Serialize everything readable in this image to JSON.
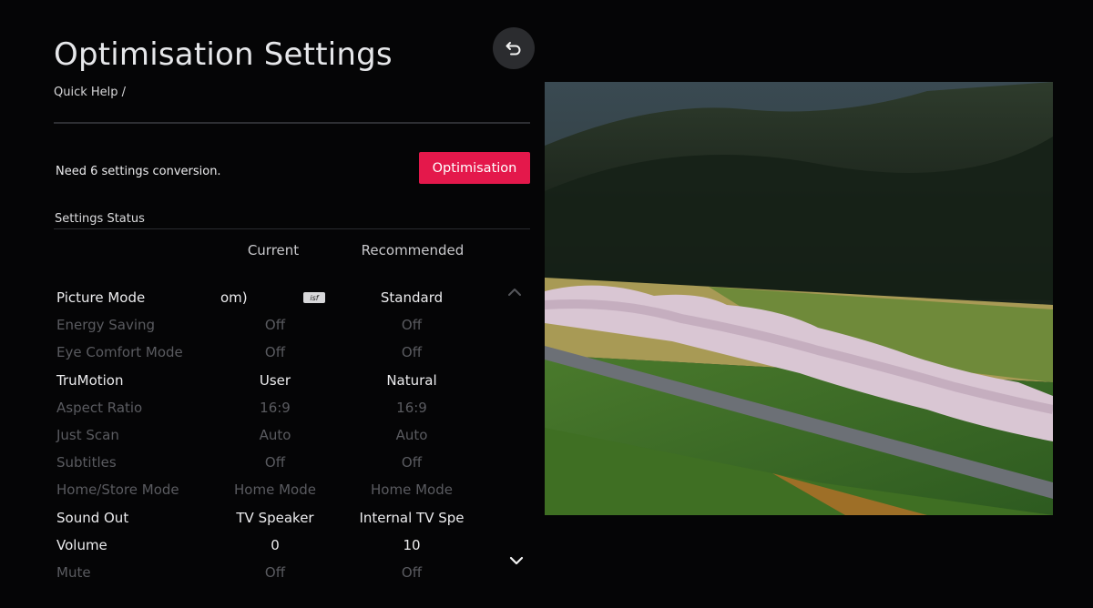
{
  "header": {
    "title": "Optimisation Settings",
    "breadcrumb": "Quick Help /"
  },
  "notice": {
    "text": "Need 6 settings conversion.",
    "button_label": "Optimisation"
  },
  "status": {
    "title": "Settings Status",
    "col_current": "Current",
    "col_recommended": "Recommended",
    "rows": [
      {
        "label": "Picture Mode",
        "current": "om)",
        "recommended": "Standard",
        "badge": "isf"
      },
      {
        "label": "Energy Saving",
        "current": "Off",
        "recommended": "Off"
      },
      {
        "label": "Eye Comfort Mode",
        "current": "Off",
        "recommended": "Off"
      },
      {
        "label": "TruMotion",
        "current": "User",
        "recommended": "Natural"
      },
      {
        "label": "Aspect Ratio",
        "current": "16:9",
        "recommended": "16:9"
      },
      {
        "label": "Just Scan",
        "current": "Auto",
        "recommended": "Auto"
      },
      {
        "label": "Subtitles",
        "current": "Off",
        "recommended": "Off"
      },
      {
        "label": "Home/Store Mode",
        "current": "Home Mode",
        "recommended": "Home Mode"
      },
      {
        "label": "Sound Out",
        "current": "TV Speaker",
        "recommended": "Internal TV Spe"
      },
      {
        "label": "Volume",
        "current": "0",
        "recommended": "10"
      },
      {
        "label": "Mute",
        "current": "Off",
        "recommended": "Off"
      }
    ]
  },
  "colors": {
    "accent": "#e4184b",
    "background": "#050506"
  }
}
